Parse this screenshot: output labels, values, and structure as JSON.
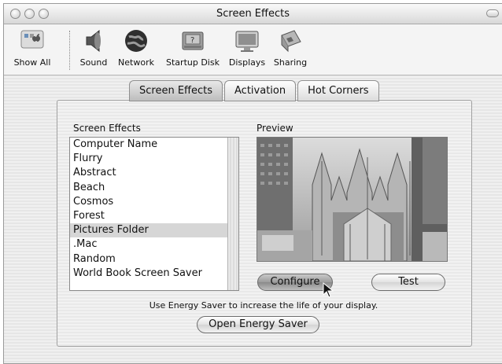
{
  "window": {
    "title": "Screen Effects"
  },
  "toolbar": {
    "items": [
      {
        "label": "Show All",
        "icon": "apple-icon"
      },
      {
        "label": "Sound",
        "icon": "speaker-icon"
      },
      {
        "label": "Network",
        "icon": "globe-icon"
      },
      {
        "label": "Startup Disk",
        "icon": "disk-icon"
      },
      {
        "label": "Displays",
        "icon": "display-icon"
      },
      {
        "label": "Sharing",
        "icon": "sharing-icon"
      }
    ]
  },
  "tabs": [
    {
      "label": "Screen Effects",
      "selected": true
    },
    {
      "label": "Activation",
      "selected": false
    },
    {
      "label": "Hot Corners",
      "selected": false
    }
  ],
  "effects": {
    "heading": "Screen Effects",
    "items": [
      "Computer Name",
      "Flurry",
      "Abstract",
      "Beach",
      "Cosmos",
      "Forest",
      "Pictures Folder",
      ".Mac",
      "Random",
      "World Book Screen Saver"
    ],
    "selected": "Pictures Folder"
  },
  "preview": {
    "heading": "Preview"
  },
  "buttons": {
    "configure": "Configure",
    "test": "Test",
    "open_energy": "Open Energy Saver"
  },
  "hint": "Use Energy Saver to increase the life of your display."
}
